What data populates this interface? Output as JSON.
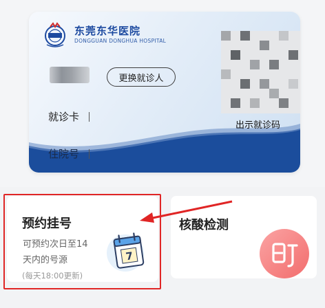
{
  "hospital": {
    "name_cn": "东莞东华医院",
    "name_en": "DONGGUAN DONGHUA HOSPITAL"
  },
  "card": {
    "change_button": "更换就诊人",
    "card_label": "就诊卡",
    "inpatient_label": "住院号",
    "qr_caption": "出示就诊码"
  },
  "services": {
    "appointment": {
      "title": "预约挂号",
      "desc_line1": "可预约次日至14",
      "desc_line2": "天内的号源",
      "note": "(每天18:00更新)",
      "calendar_day": "7"
    },
    "nucleic": {
      "title": "核酸检测"
    }
  },
  "colors": {
    "brand_blue": "#1d4aa0",
    "wave_blue": "#1b4d9c",
    "highlight_red": "#e02525",
    "nucleic_pink": "#f26d6d"
  }
}
